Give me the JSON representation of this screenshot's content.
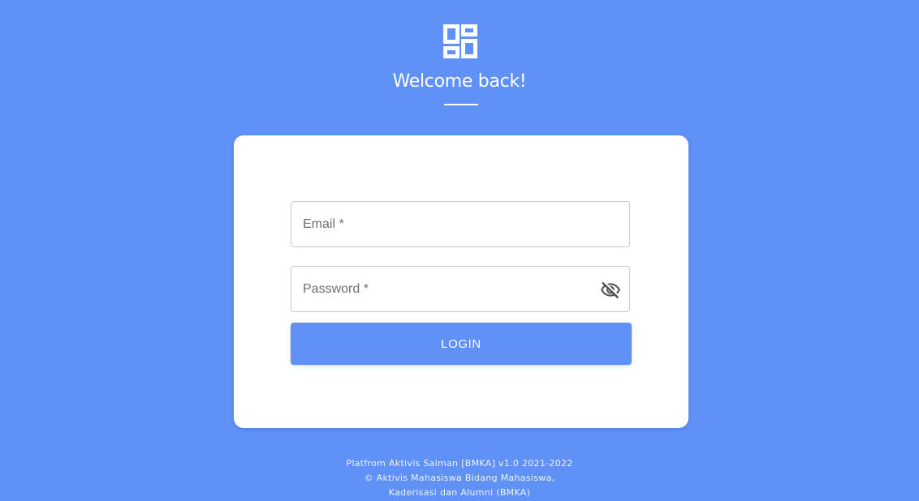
{
  "header": {
    "logo_icon": "dashboard-grid-icon",
    "title": "Welcome back!"
  },
  "form": {
    "email": {
      "label": "Email *",
      "value": ""
    },
    "password": {
      "label": "Password *",
      "value": "",
      "toggle_icon": "eye-off-icon"
    },
    "login_label": "LOGIN"
  },
  "footer": {
    "line1": "Platfrom Aktivis Salman [BMKA] v1.0 2021-2022",
    "line2": "© Aktivis Mahasiswa Bidang Mahasiswa,",
    "line3": "Kaderisasi dan Alumni (BMKA)"
  },
  "colors": {
    "background": "#5f91f7",
    "card": "#ffffff",
    "button": "#5f91f7",
    "button_text": "#ffffff"
  }
}
